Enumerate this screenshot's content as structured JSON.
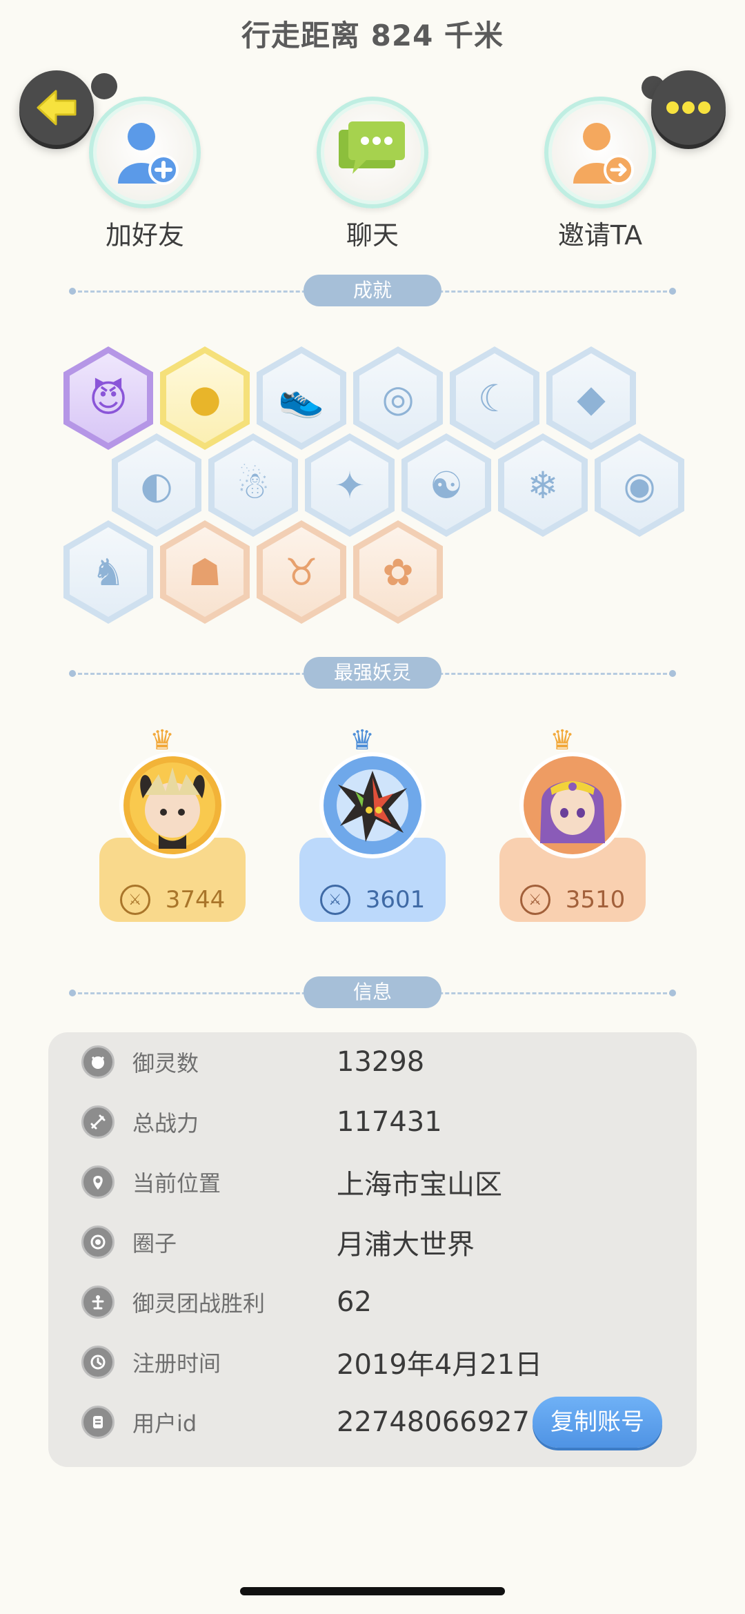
{
  "header": {
    "title": "行走距离 824 千米"
  },
  "actions": [
    {
      "label": "加好友",
      "icon": "add-friend-icon",
      "color": "#5b9ae8"
    },
    {
      "label": "聊天",
      "icon": "chat-icon",
      "color": "#9ccc4a"
    },
    {
      "label": "邀请TA",
      "icon": "invite-icon",
      "color": "#f4a85e"
    }
  ],
  "sections": {
    "achievements": "成就",
    "strongest": "最强妖灵",
    "info": "信息"
  },
  "achievements": [
    {
      "name": "devil",
      "color": "purple",
      "glyph": "😈"
    },
    {
      "name": "golden-ball",
      "color": "yellow",
      "glyph": "●"
    },
    {
      "name": "sneaker",
      "color": "blue",
      "glyph": "👟"
    },
    {
      "name": "target-pin",
      "color": "blue",
      "glyph": "◎"
    },
    {
      "name": "moon",
      "color": "blue",
      "glyph": "☾"
    },
    {
      "name": "crystal",
      "color": "blue",
      "glyph": "◆"
    },
    {
      "name": "swirl-orb",
      "color": "blue",
      "glyph": "◐"
    },
    {
      "name": "snowman",
      "color": "blue",
      "glyph": "☃"
    },
    {
      "name": "cat-star",
      "color": "blue",
      "glyph": "✦"
    },
    {
      "name": "yin-yang",
      "color": "blue",
      "glyph": "☯"
    },
    {
      "name": "fish",
      "color": "blue",
      "glyph": "❄"
    },
    {
      "name": "scroll",
      "color": "blue",
      "glyph": "◉"
    },
    {
      "name": "cat-back",
      "color": "blue",
      "glyph": "♞"
    },
    {
      "name": "cat-cart",
      "color": "orange",
      "glyph": "☗"
    },
    {
      "name": "ox",
      "color": "orange",
      "glyph": "♉"
    },
    {
      "name": "fox-book",
      "color": "orange",
      "glyph": "✿"
    }
  ],
  "strongest": [
    {
      "power": "3744",
      "card_color": "#f9d98c",
      "ring_color": "#f2b338",
      "text_color": "#a9752a",
      "crown": "♛",
      "crown_color": "#f2a93b"
    },
    {
      "power": "3601",
      "card_color": "#bcd9fb",
      "ring_color": "#6fa8ea",
      "text_color": "#3f6aa5",
      "crown": "♛",
      "crown_color": "#4f8fd8"
    },
    {
      "power": "3510",
      "card_color": "#f9d0b0",
      "ring_color": "#ee9c63",
      "text_color": "#a2603a",
      "crown": "♛",
      "crown_color": "#f2a93b"
    }
  ],
  "info": [
    {
      "label": "御灵数",
      "value": "13298",
      "icon": "spirit-icon"
    },
    {
      "label": "总战力",
      "value": "117431",
      "icon": "sword-icon"
    },
    {
      "label": "当前位置",
      "value": "上海市宝山区",
      "icon": "location-icon"
    },
    {
      "label": "圈子",
      "value": "月浦大世界",
      "icon": "circle-icon"
    },
    {
      "label": "御灵团战胜利",
      "value": "62",
      "icon": "trophy-icon"
    },
    {
      "label": "注册时间",
      "value": "2019年4月21日",
      "icon": "clock-icon"
    },
    {
      "label": "用户id",
      "value": "22748066927",
      "icon": "id-card-icon"
    }
  ],
  "copy_button": "复制账号"
}
